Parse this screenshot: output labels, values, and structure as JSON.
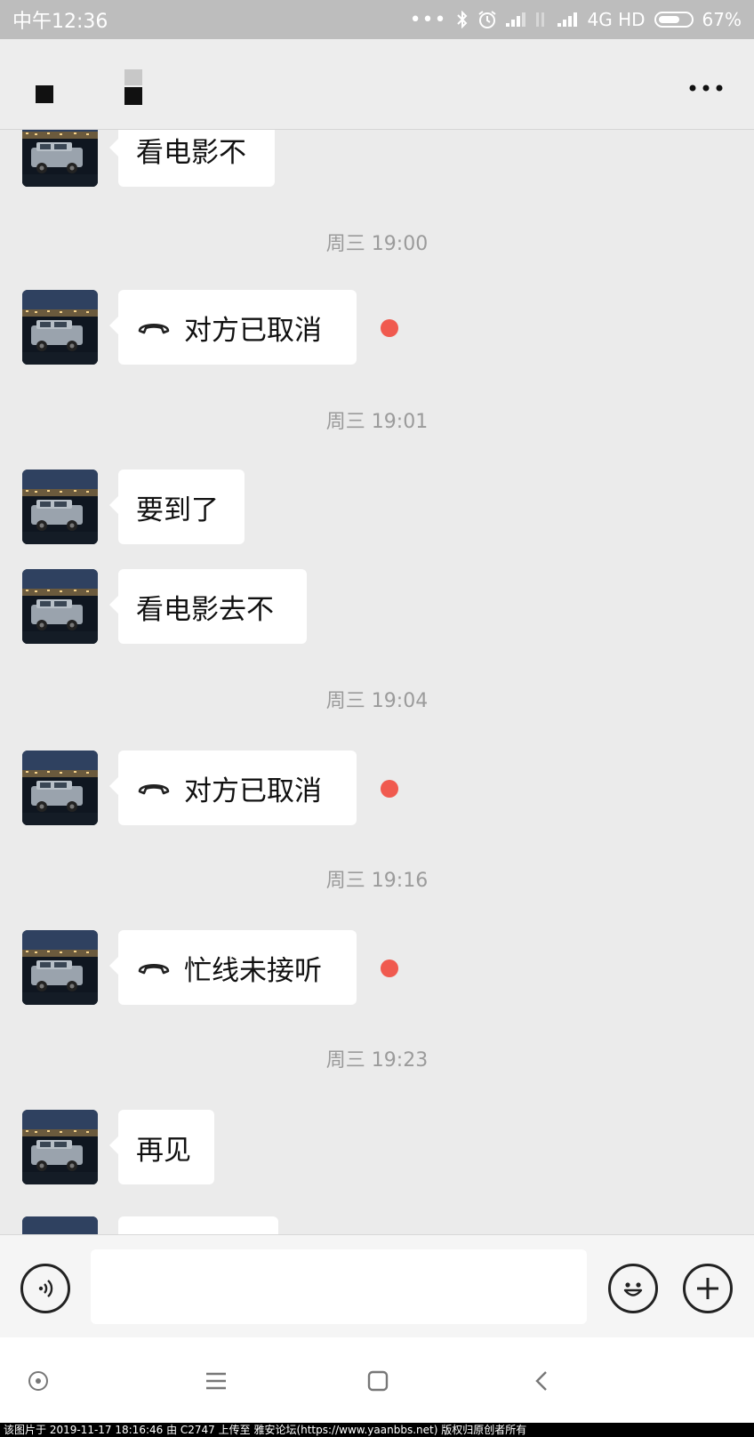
{
  "status_bar": {
    "time": "中午12:36",
    "network": "4G HD",
    "battery": "67%",
    "battery_level": 0.67
  },
  "header": {
    "more_icon": "more-horizontal-icon"
  },
  "chat": {
    "bubble_1": "看电影不",
    "timestamp_1": "周三 19:00",
    "call_1": "对方已取消",
    "timestamp_2": "周三 19:01",
    "bubble_2": "要到了",
    "bubble_3": "看电影去不",
    "timestamp_3": "周三 19:04",
    "call_2": "对方已取消",
    "timestamp_4": "周三 19:16",
    "call_3": "忙线未接听",
    "timestamp_5": "周三 19:23",
    "bubble_4": "再见"
  },
  "input_bar": {
    "voice_icon": "voice-icon",
    "emoji_icon": "emoji-icon",
    "plus_icon": "plus-icon",
    "placeholder": ""
  },
  "colors": {
    "unread_dot": "#f05a4f",
    "background": "#ebebeb",
    "status_bar": "#bdbdbd"
  },
  "watermark": "该图片于 2019-11-17 18:16:46 由 C2747 上传至 雅安论坛(https://www.yaanbbs.net) 版权归原创者所有"
}
